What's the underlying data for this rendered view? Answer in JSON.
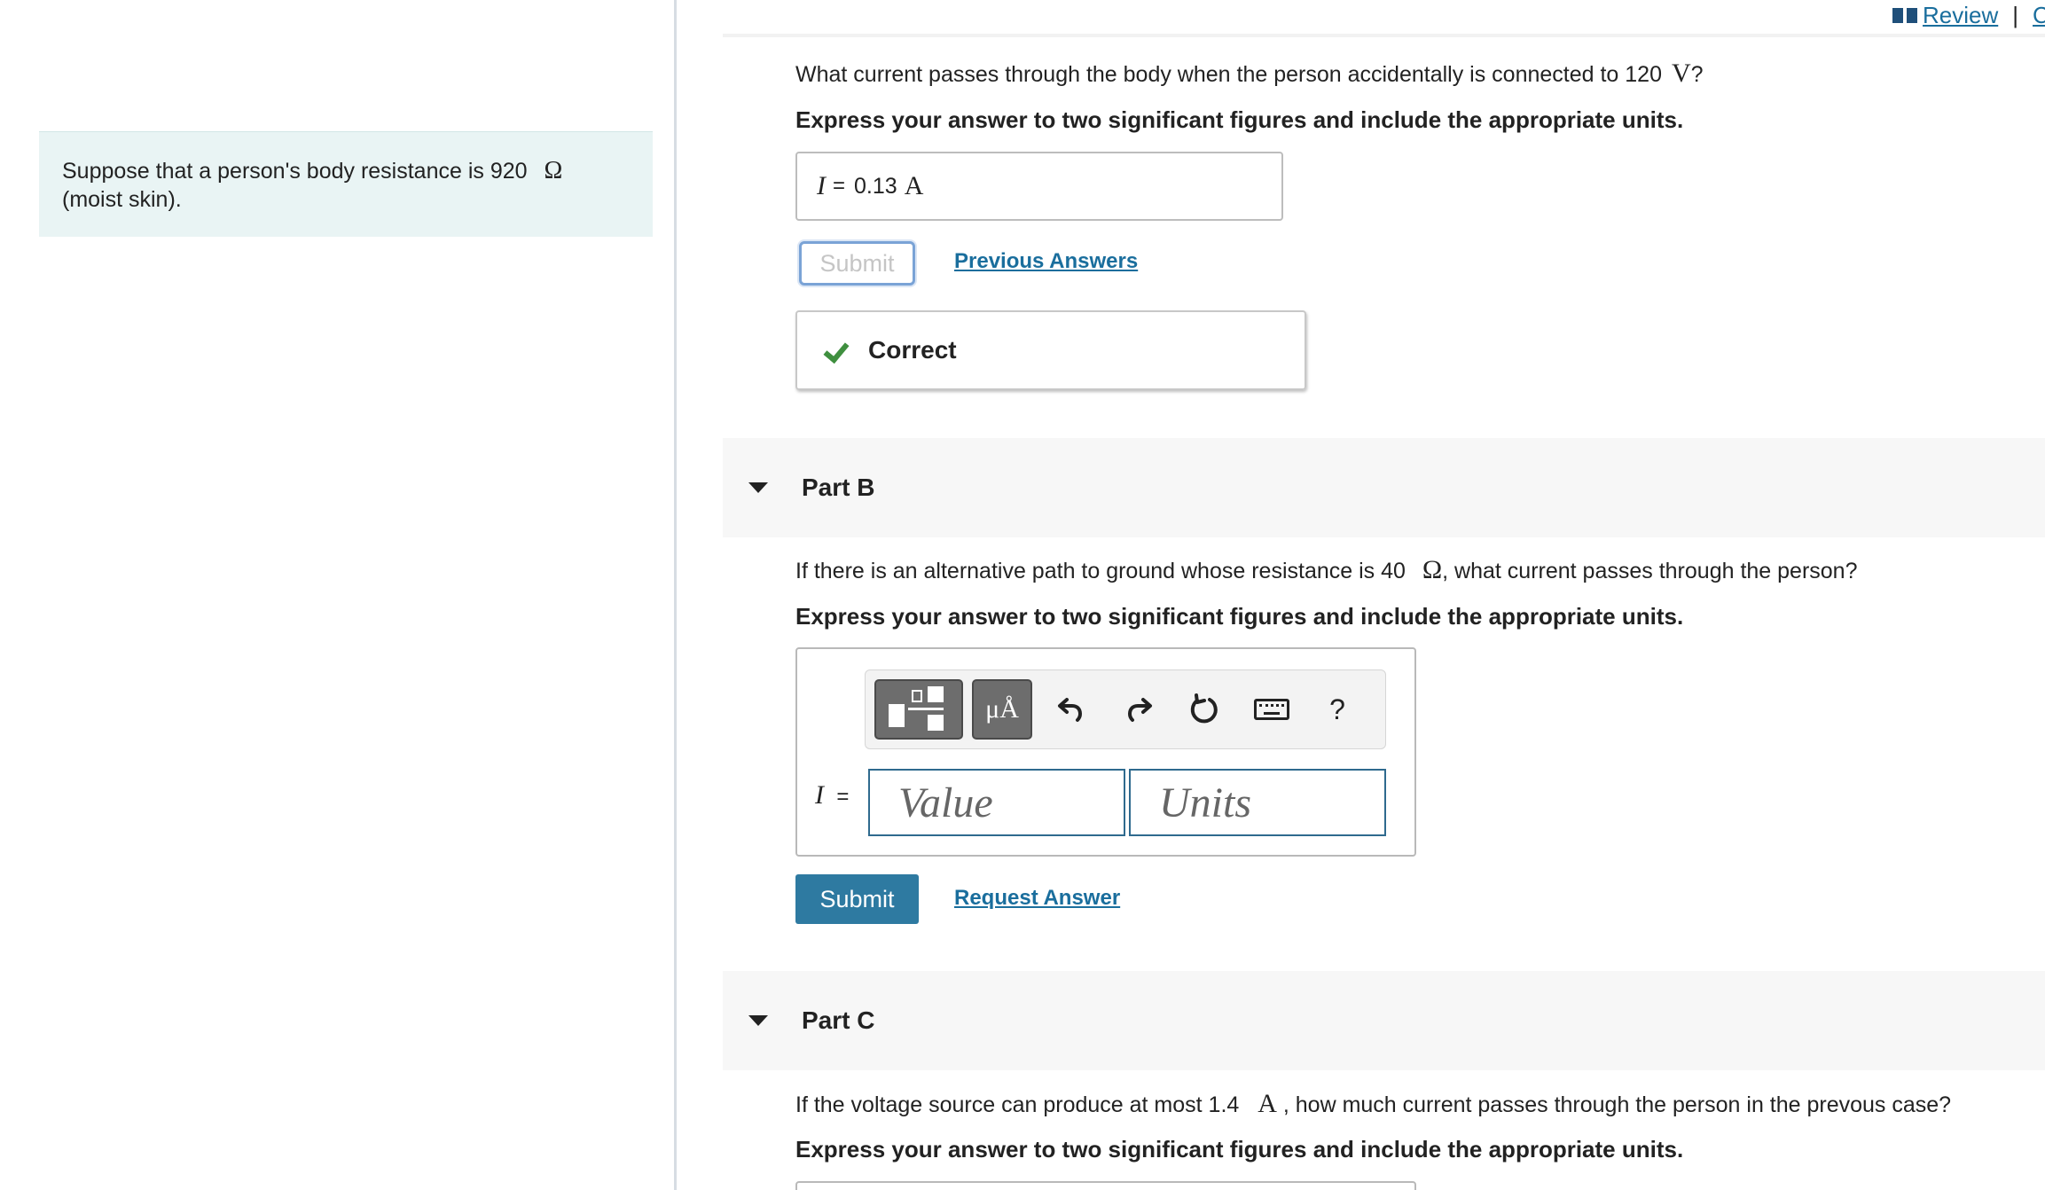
{
  "header": {
    "review_label": "Review",
    "separator": "|",
    "next_label": "C"
  },
  "left_panel": {
    "intro_text": "Suppose that a person's body resistance is 920",
    "intro_unit": "Ω",
    "intro_text_line2": "(moist skin)."
  },
  "part_a": {
    "question_text": "What current passes through the body when the person accidentally is connected to 120",
    "question_unit": "V",
    "question_end": "?",
    "instruction": "Express your answer to two significant figures and include the appropriate units.",
    "answer_var": "I",
    "answer_eq": "=",
    "answer_value": "0.13",
    "answer_unit": "A",
    "submit_label": "Submit",
    "previous_answers_label": "Previous Answers",
    "feedback_label": "Correct"
  },
  "part_b": {
    "title": "Part B",
    "question_text": "If there is an alternative path to ground whose resistance is 40",
    "question_unit": "Ω",
    "question_end": ", what current passes through the person?",
    "instruction": "Express your answer to two significant figures and include the appropriate units.",
    "toolbar": {
      "units_label": "μÅ",
      "help_label": "?"
    },
    "answer_var": "I",
    "answer_eq": "=",
    "value_placeholder": "Value",
    "units_placeholder": "Units",
    "submit_label": "Submit",
    "request_answer_label": "Request Answer"
  },
  "part_c": {
    "title": "Part C",
    "question_text": "If the voltage source can produce at most 1.4",
    "question_unit": "A",
    "question_end": ", how much current passes through the person in the prevous case?",
    "instruction": "Express your answer to two significant figures and include the appropriate units."
  },
  "colors": {
    "link": "#1a6e9d",
    "intro_bg": "#e9f4f4",
    "primary_button": "#2e7aa1",
    "check": "#3f8f3f",
    "part_header_bg": "#f7f7f7"
  }
}
